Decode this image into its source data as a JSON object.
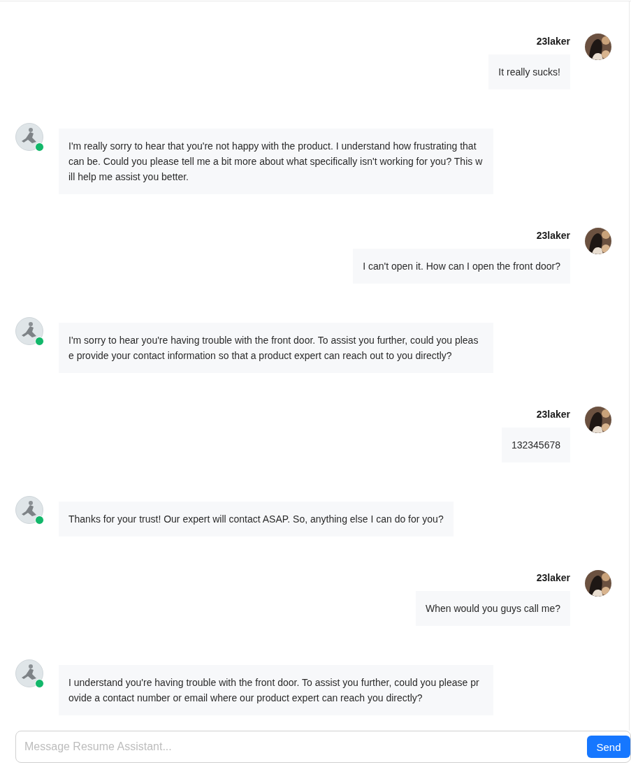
{
  "messages": [
    {
      "kind": "user",
      "sender": "23laker",
      "text": "It really sucks!"
    },
    {
      "kind": "assistant",
      "online": true,
      "text": "I'm really sorry to hear that you're not happy with the product. I understand how frustrating that can be. Could you please tell me a bit more about what specifically isn't working for you? This will help me assist you better."
    },
    {
      "kind": "user",
      "sender": "23laker",
      "text": "I can't open it. How can I open the front door?"
    },
    {
      "kind": "assistant",
      "online": true,
      "text": "I'm sorry to hear you're having trouble with the front door. To assist you further, could you please provide your contact information so that a product expert can reach out to you directly?"
    },
    {
      "kind": "user",
      "sender": "23laker",
      "text": "132345678"
    },
    {
      "kind": "assistant",
      "online": true,
      "text": "Thanks for your trust! Our expert will contact ASAP. So, anything else I can do for you?"
    },
    {
      "kind": "user",
      "sender": "23laker",
      "text": "When would you guys call me?"
    },
    {
      "kind": "assistant",
      "online": true,
      "text": "I understand you're having trouble with the front door. To assist you further, could you please provide a contact number or email where our product expert can reach you directly?"
    }
  ],
  "composer": {
    "placeholder": "Message Resume Assistant...",
    "send_label": "Send"
  }
}
